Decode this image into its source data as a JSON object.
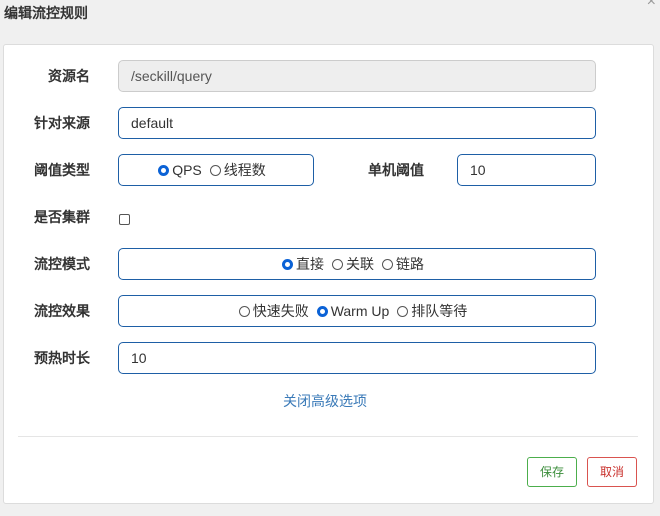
{
  "dialog": {
    "title": "编辑流控规则",
    "close_symbol": "×"
  },
  "form": {
    "resource": {
      "label": "资源名",
      "value": "/seckill/query"
    },
    "limit_app": {
      "label": "针对来源",
      "value": "default"
    },
    "grade": {
      "label": "阈值类型",
      "options": [
        {
          "label": "QPS",
          "checked": true
        },
        {
          "label": "线程数",
          "checked": false
        }
      ]
    },
    "count": {
      "label": "单机阈值",
      "value": "10"
    },
    "cluster": {
      "label": "是否集群",
      "checked": false
    },
    "strategy": {
      "label": "流控模式",
      "options": [
        {
          "label": "直接",
          "checked": true
        },
        {
          "label": "关联",
          "checked": false
        },
        {
          "label": "链路",
          "checked": false
        }
      ]
    },
    "control_behavior": {
      "label": "流控效果",
      "options": [
        {
          "label": "快速失败",
          "checked": false
        },
        {
          "label": "Warm Up",
          "checked": true
        },
        {
          "label": "排队等待",
          "checked": false
        }
      ]
    },
    "warm_up_period": {
      "label": "预热时长",
      "value": "10"
    },
    "advanced_toggle": "关闭高级选项"
  },
  "footer": {
    "save_label": "保存",
    "cancel_label": "取消"
  }
}
